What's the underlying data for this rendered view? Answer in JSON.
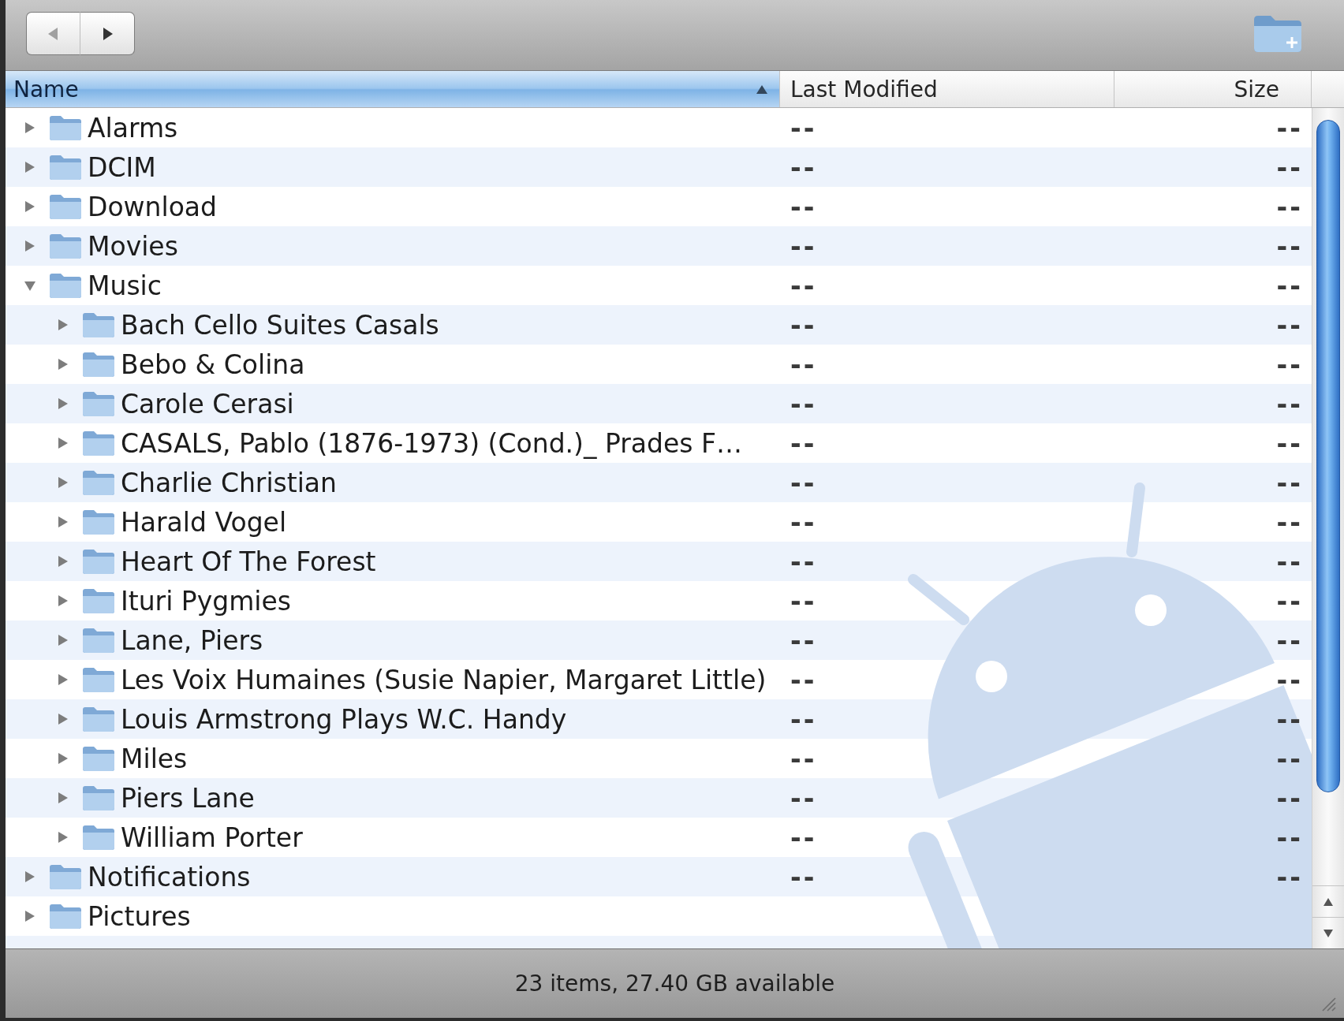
{
  "toolbar": {
    "nav_buttons": [
      {
        "kind": "back",
        "disabled": true
      },
      {
        "kind": "forward",
        "disabled": false
      }
    ]
  },
  "columns": [
    {
      "label": "Name",
      "selected": true,
      "sorted": true
    },
    {
      "label": "Last Modified",
      "selected": false,
      "sorted": false
    },
    {
      "label": "Size",
      "selected": false,
      "sorted": false
    }
  ],
  "items": [
    {
      "name": "Alarms",
      "last_modified": "--",
      "size": "--",
      "expanded": false
    },
    {
      "name": "DCIM",
      "last_modified": "--",
      "size": "--",
      "expanded": false
    },
    {
      "name": "Download",
      "last_modified": "--",
      "size": "--",
      "expanded": false
    },
    {
      "name": "Movies",
      "last_modified": "--",
      "size": "--",
      "expanded": false
    },
    {
      "name": "Music",
      "last_modified": "--",
      "size": "--",
      "expanded": true,
      "children": [
        {
          "name": "Bach Cello Suites Casals",
          "last_modified": "--",
          "size": "--",
          "expanded": false
        },
        {
          "name": "Bebo & Colina",
          "last_modified": "--",
          "size": "--",
          "expanded": false
        },
        {
          "name": "Carole Cerasi",
          "last_modified": "--",
          "size": "--",
          "expanded": false
        },
        {
          "name": "CASALS, Pablo (1876-1973) (Cond.)_ Prades F…",
          "last_modified": "--",
          "size": "--",
          "expanded": false
        },
        {
          "name": "Charlie Christian",
          "last_modified": "--",
          "size": "--",
          "expanded": false
        },
        {
          "name": "Harald Vogel",
          "last_modified": "--",
          "size": "--",
          "expanded": false
        },
        {
          "name": "Heart Of The Forest",
          "last_modified": "--",
          "size": "--",
          "expanded": false
        },
        {
          "name": "Ituri Pygmies",
          "last_modified": "--",
          "size": "--",
          "expanded": false
        },
        {
          "name": "Lane, Piers",
          "last_modified": "--",
          "size": "--",
          "expanded": false
        },
        {
          "name": "Les Voix Humaines (Susie Napier, Margaret Little)",
          "last_modified": "--",
          "size": "--",
          "expanded": false
        },
        {
          "name": "Louis Armstrong Plays W.C. Handy",
          "last_modified": "--",
          "size": "--",
          "expanded": false
        },
        {
          "name": "Miles",
          "last_modified": "--",
          "size": "--",
          "expanded": false
        },
        {
          "name": "Piers Lane",
          "last_modified": "--",
          "size": "--",
          "expanded": false
        },
        {
          "name": "William Porter",
          "last_modified": "--",
          "size": "--",
          "expanded": false
        }
      ]
    },
    {
      "name": "Notifications",
      "last_modified": "--",
      "size": "--",
      "expanded": false
    },
    {
      "name": "Pictures",
      "expanded": false
    }
  ],
  "status_bar": {
    "text": "23 items, 27.40 GB available"
  }
}
